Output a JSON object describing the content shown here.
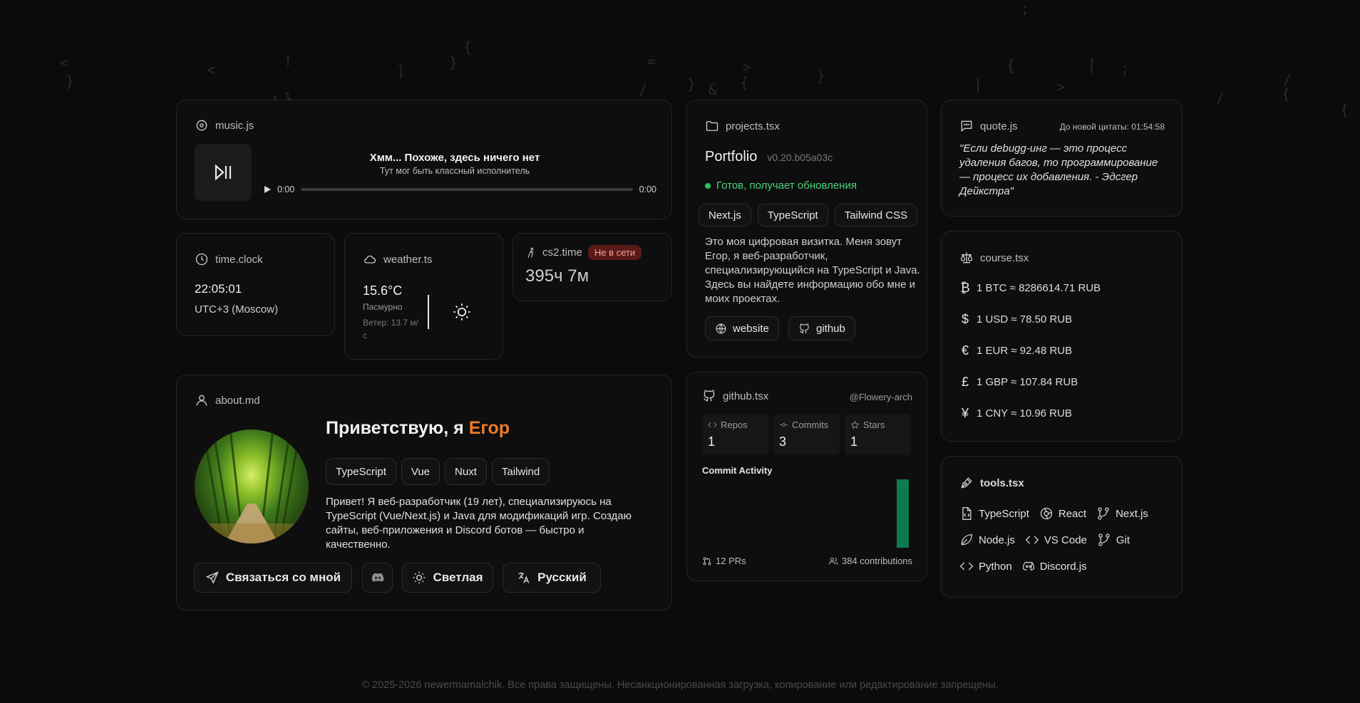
{
  "background_glyphs": [
    "<",
    "}",
    "<",
    "!",
    "]",
    "}",
    "{",
    "]",
    "}",
    "=",
    ">",
    "/",
    "}",
    "&",
    "{",
    "}",
    "{",
    "|",
    "[",
    ">",
    ";",
    "/",
    "{",
    "/",
    "{",
    ";"
  ],
  "music": {
    "title": "music.js",
    "song": "Хмм... Похоже, здесь ничего нет",
    "artist": "Тут мог быть классный исполнитель",
    "time_current": "0:00",
    "time_total": "0:00",
    "progress": 0
  },
  "clock": {
    "title": "time.clock",
    "time": "22:05:01",
    "zone": "UTC+3 (Moscow)"
  },
  "weather": {
    "title": "weather.ts",
    "temp": "15.6°C",
    "condition": "Пасмурно",
    "wind": "Ветер: 13.7 м/с"
  },
  "cs2": {
    "title": "cs2.time",
    "status": "Не в сети",
    "hours": "395ч 7м"
  },
  "about": {
    "title": "about.md",
    "greeting": "Приветствую, я",
    "name": "Егор",
    "tags": [
      "TypeScript",
      "Vue",
      "Nuxt",
      "Tailwind"
    ],
    "bio": "Привет! Я веб-разработчик (19 лет), специализируюсь на TypeScript (Vue/Next.js) и Java для модификаций игр. Создаю сайты, веб-приложения и Discord ботов — быстро и качественно.",
    "buttons": {
      "contact": "Связаться со мной",
      "theme": "Светлая",
      "language": "Русский"
    }
  },
  "projects": {
    "title": "projects.tsx",
    "name": "Portfolio",
    "version": "v0.20.b05a03c",
    "status": "Готов, получает обновления",
    "status_color": "#22c55e",
    "tags": [
      "Next.js",
      "TypeScript",
      "Tailwind CSS"
    ],
    "description": "Это моя цифровая визитка. Меня зовут Егор, я веб-разработчик, специализирующийся на TypeScript и Java. Здесь вы найдете информацию обо мне и моих проектах.",
    "links": {
      "website": "website",
      "github": "github"
    }
  },
  "github": {
    "title": "github.tsx",
    "user": "@Flowery-arch",
    "stats": {
      "repos_label": "Repos",
      "repos": "1",
      "commits_label": "Commits",
      "commits": "3",
      "stars_label": "Stars",
      "stars": "1"
    },
    "activity_title": "Commit Activity",
    "activity_color": "#0f7a50",
    "prs": "12 PRs",
    "contributions": "384 contributions"
  },
  "quote": {
    "title": "quote.js",
    "timer": "До новой цитаты: 01:54:58",
    "text": "\"Если debugg-инг — это процесс удаления багов, то программирование — процесс их добавления. - Эдсгер Дейкстра\""
  },
  "course": {
    "title": "course.tsx",
    "rates": [
      {
        "symbol": "₿",
        "text": "1 BTC ≈ 8286614.71 RUB"
      },
      {
        "symbol": "$",
        "text": "1 USD ≈ 78.50 RUB"
      },
      {
        "symbol": "€",
        "text": "1 EUR ≈ 92.48 RUB"
      },
      {
        "symbol": "£",
        "text": "1 GBP ≈ 107.84 RUB"
      },
      {
        "symbol": "¥",
        "text": "1 CNY ≈ 10.96 RUB"
      }
    ]
  },
  "tools": {
    "title": "tools.tsx",
    "items": [
      "TypeScript",
      "React",
      "Next.js",
      "Node.js",
      "VS Code",
      "Git",
      "Python",
      "Discord.js"
    ]
  },
  "footer": "© 2025-2026 newermamalchik. Все права защищены. Несанкционированная загрузка, копирование или редактирование запрещены.",
  "colors": {
    "accent": "#f07a2a",
    "badge_bg": "#5a1a1a",
    "badge_text": "#ff9d8a"
  }
}
